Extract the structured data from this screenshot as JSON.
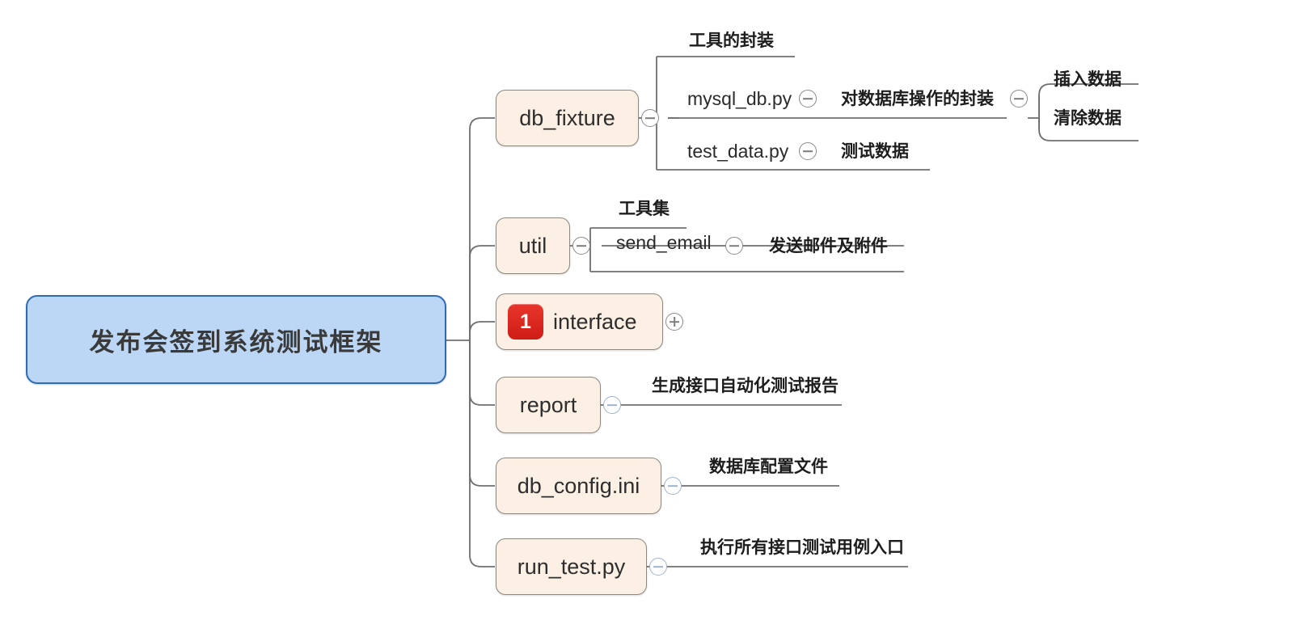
{
  "diagram": {
    "type": "mind-map",
    "title": "发布会签到系统测试框架",
    "colors": {
      "root_fill": "#bcd7f5",
      "root_border": "#2f6cb5",
      "branch_fill": "#fcefe3",
      "branch_border": "#8d8880",
      "edge": "#6f6f6f",
      "badge": "#d8251c",
      "toggle": "#8a8a8a",
      "toggle_blue": "#9fb2cf"
    }
  },
  "root": {
    "label": "发布会签到系统测试框架",
    "toggle": "minus"
  },
  "branches": [
    {
      "id": "db_fixture",
      "label": "db_fixture",
      "toggle": "minus",
      "group_label": "工具的封装",
      "children": [
        {
          "label": "mysql_db.py",
          "toggle": "minus",
          "note": "对数据库操作的封装",
          "note_toggle": "minus",
          "subitems": [
            "插入数据",
            "清除数据"
          ]
        },
        {
          "label": "test_data.py",
          "toggle": "minus",
          "note": "测试数据"
        }
      ]
    },
    {
      "id": "util",
      "label": "util",
      "toggle": "minus",
      "group_label": "工具集",
      "children": [
        {
          "label": "send_email",
          "toggle": "minus",
          "note": "发送邮件及附件"
        }
      ]
    },
    {
      "id": "interface",
      "label": "interface",
      "badge": "1",
      "toggle": "plus"
    },
    {
      "id": "report",
      "label": "report",
      "toggle": "minus",
      "note": "生成接口自动化测试报告"
    },
    {
      "id": "db_config",
      "label": "db_config.ini",
      "toggle": "minus",
      "note": "数据库配置文件"
    },
    {
      "id": "run_test",
      "label": "run_test.py",
      "toggle": "minus",
      "note": "执行所有接口测试用例入口"
    }
  ]
}
